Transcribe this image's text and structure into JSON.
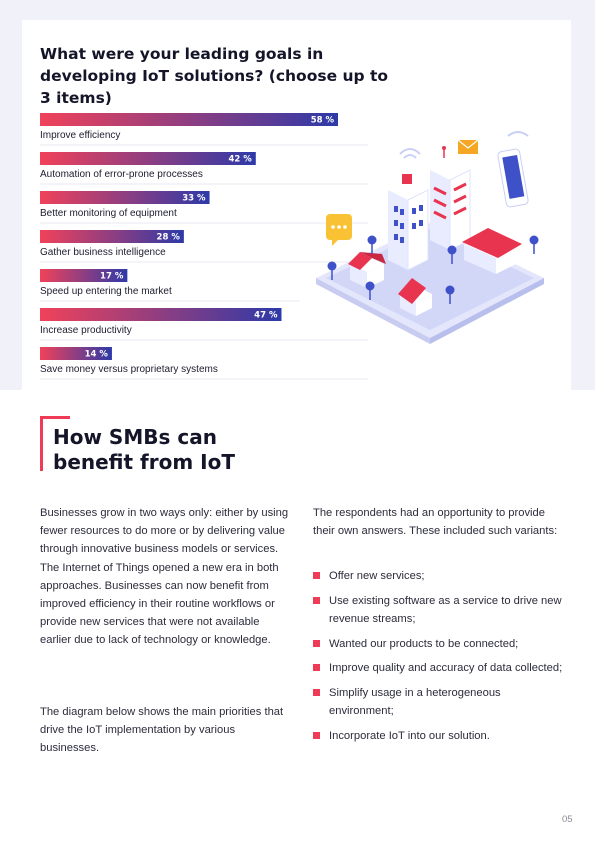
{
  "chart_title": "What were your leading goals in developing IoT solutions? (choose up to 3 items)",
  "chart_data": {
    "type": "bar",
    "orientation": "horizontal",
    "categories": [
      "Improve efficiency",
      "Automation of error-prone processes",
      "Better monitoring of equipment",
      "Gather business intelligence",
      "Speed up entering the market",
      "Increase productivity",
      "Save money versus proprietary systems"
    ],
    "values": [
      58,
      42,
      33,
      28,
      17,
      47,
      14
    ],
    "value_labels": [
      "58 %",
      "42 %",
      "33 %",
      "28 %",
      "17 %",
      "47 %",
      "14 %"
    ],
    "unit": "%",
    "gradient_start": "#f0425a",
    "gradient_end": "#2d3aa8",
    "grid": false,
    "legend": "none"
  },
  "section": {
    "heading": "How SMBs can benefit from IoT",
    "accent_color": "#ef3b55",
    "paragraph_1": "Businesses grow in two ways only: either by using fewer resources to do more or by delivering value through innovative business models or services. The Internet of Things opened a new era in both approaches. Businesses can now benefit from improved efficiency in their routine workflows or provide new services that were not available earlier due to lack of technology or knowledge.",
    "paragraph_2": "The diagram below shows the main priorities that drive the IoT implementation by various businesses.",
    "right_intro": "The respondents had an opportunity to provide their own answers. These included such variants:",
    "variants": [
      "Offer new services;",
      "Use existing software as a service to drive new revenue streams;",
      "Wanted our products to be connected;",
      "Improve quality and accuracy of data collected;",
      "Simplify usage in a heterogeneous environment;",
      "Incorporate IoT into our solution."
    ]
  },
  "page_number": "05"
}
